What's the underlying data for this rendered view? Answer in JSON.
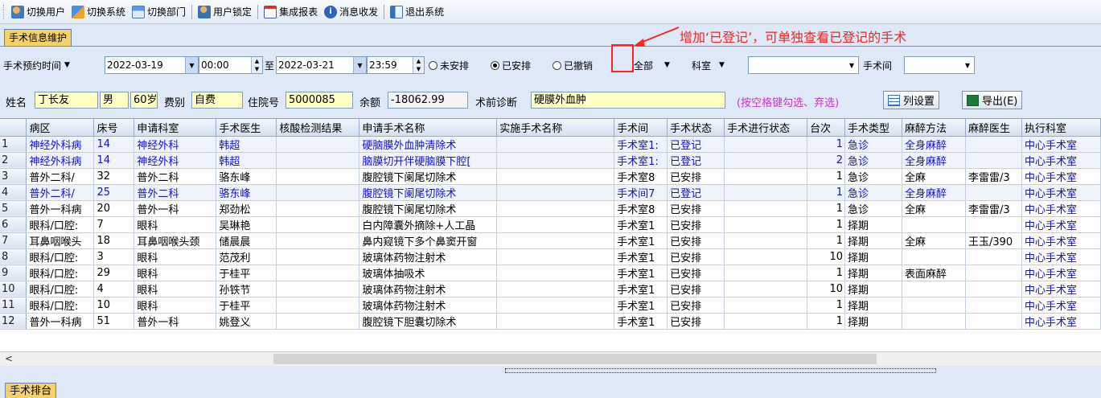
{
  "toolbar": {
    "items": [
      {
        "label": "切换用户",
        "icon": "switch-user-icon"
      },
      {
        "label": "切换系统",
        "icon": "switch-system-icon"
      },
      {
        "label": "切换部门",
        "icon": "switch-dept-icon"
      },
      {
        "label": "用户锁定",
        "icon": "user-lock-icon"
      },
      {
        "label": "集成报表",
        "icon": "report-icon"
      },
      {
        "label": "消息收发",
        "icon": "info-icon"
      },
      {
        "label": "退出系统",
        "icon": "exit-icon"
      }
    ]
  },
  "top_tab": "手术信息维护",
  "annotation": "增加‘已登记’，可单独查看已登记的手术",
  "filter": {
    "time_type": "手术预约时间",
    "date_from": "2022-03-19",
    "time_from": "00:00",
    "to_label": "至",
    "date_to": "2022-03-21",
    "time_to": "23:59",
    "radios": [
      {
        "label": "未安排",
        "checked": false
      },
      {
        "label": "已安排",
        "checked": true
      },
      {
        "label": "已撤销",
        "checked": false
      }
    ],
    "scope": "全部",
    "dept_type": "科室",
    "dept_value": "",
    "room_label": "手术间",
    "room_value": ""
  },
  "patient": {
    "name_label": "姓名",
    "name": "丁长友",
    "sex": "男",
    "age": "60岁",
    "fee_label": "费别",
    "fee": "自费",
    "inpatient_label": "住院号",
    "inpatient_no": "5000085",
    "balance_label": "余额",
    "balance": "-18062.99",
    "diag_label": "术前诊断",
    "diag": "硬膜外血肿",
    "hint": "(按空格键勾选、弃选)",
    "col_settings": "列设置",
    "export": "导出(E)"
  },
  "grid": {
    "columns": [
      "病区",
      "床号",
      "申请科室",
      "手术医生",
      "核酸检测结果",
      "申请手术名称",
      "实施手术名称",
      "手术间",
      "手术状态",
      "手术进行状态",
      "台次",
      "手术类型",
      "麻醉方法",
      "麻醉医生",
      "执行科室"
    ],
    "rows": [
      {
        "n": "1",
        "blue": true,
        "sel": true,
        "c": [
          "神经外科病",
          "14",
          "神经外科",
          "韩超",
          "",
          "硬脑膜外血肿清除术",
          "",
          "手术室1:",
          "已登记",
          "",
          "1",
          "急诊",
          "全身麻醉",
          "",
          "中心手术室"
        ]
      },
      {
        "n": "2",
        "blue": true,
        "sel": true,
        "c": [
          "神经外科病",
          "14",
          "神经外科",
          "韩超",
          "",
          "脑膜切开伴硬脑膜下腔[",
          "",
          "手术室1:",
          "已登记",
          "",
          "2",
          "急诊",
          "全身麻醉",
          "",
          "中心手术室"
        ]
      },
      {
        "n": "3",
        "blue": false,
        "sel": false,
        "c": [
          "普外二科/",
          "32",
          "普外二科",
          "骆东峰",
          "",
          "腹腔镜下阑尾切除术",
          "",
          "手术室8",
          "已安排",
          "",
          "1",
          "急诊",
          "全麻",
          "李雷雷/3",
          "中心手术室"
        ]
      },
      {
        "n": "4",
        "blue": true,
        "sel": true,
        "c": [
          "普外二科/",
          "25",
          "普外二科",
          "骆东峰",
          "",
          "腹腔镜下阑尾切除术",
          "",
          "手术间7",
          "已登记",
          "",
          "1",
          "急诊",
          "全身麻醉",
          "",
          "中心手术室"
        ]
      },
      {
        "n": "5",
        "blue": false,
        "sel": false,
        "c": [
          "普外一科病",
          "20",
          "普外一科",
          "郑劲松",
          "",
          "腹腔镜下阑尾切除术",
          "",
          "手术室8",
          "已安排",
          "",
          "1",
          "急诊",
          "全麻",
          "李雷雷/3",
          "中心手术室"
        ]
      },
      {
        "n": "6",
        "blue": false,
        "sel": false,
        "c": [
          "眼科/口腔:",
          "7",
          "眼科",
          "吴琳艳",
          "",
          "白内障囊外摘除+人工晶",
          "",
          "手术室1",
          "已安排",
          "",
          "1",
          "择期",
          "",
          "",
          "中心手术室"
        ]
      },
      {
        "n": "7",
        "blue": false,
        "sel": false,
        "c": [
          "耳鼻咽喉头",
          "18",
          "耳鼻咽喉头颈",
          "储晨晨",
          "",
          "鼻内窥镜下多个鼻窦开窗",
          "",
          "手术室1",
          "已安排",
          "",
          "1",
          "择期",
          "全麻",
          "王玉/390",
          "中心手术室"
        ]
      },
      {
        "n": "8",
        "blue": false,
        "sel": false,
        "c": [
          "眼科/口腔:",
          "3",
          "眼科",
          "范茂利",
          "",
          "玻璃体药物注射术",
          "",
          "手术室1",
          "已安排",
          "",
          "10",
          "择期",
          "",
          "",
          "中心手术室"
        ]
      },
      {
        "n": "9",
        "blue": false,
        "sel": false,
        "c": [
          "眼科/口腔:",
          "29",
          "眼科",
          "于桂平",
          "",
          "玻璃体抽吸术",
          "",
          "手术室1",
          "已安排",
          "",
          "1",
          "择期",
          "表面麻醉",
          "",
          "中心手术室"
        ]
      },
      {
        "n": "10",
        "blue": false,
        "sel": false,
        "c": [
          "眼科/口腔:",
          "4",
          "眼科",
          "孙铁节",
          "",
          "玻璃体药物注射术",
          "",
          "手术室1",
          "已安排",
          "",
          "10",
          "择期",
          "",
          "",
          "中心手术室"
        ]
      },
      {
        "n": "11",
        "blue": false,
        "sel": false,
        "c": [
          "眼科/口腔:",
          "10",
          "眼科",
          "于桂平",
          "",
          "玻璃体药物注射术",
          "",
          "手术室1",
          "已安排",
          "",
          "1",
          "择期",
          "",
          "",
          "中心手术室"
        ]
      },
      {
        "n": "12",
        "blue": false,
        "sel": false,
        "c": [
          "普外一科病",
          "51",
          "普外一科",
          "姚登义",
          "",
          "腹腔镜下胆囊切除术",
          "",
          "手术室1",
          "已安排",
          "",
          "1",
          "择期",
          "",
          "",
          "中心手术室"
        ]
      }
    ]
  },
  "bottom_tab": "手术排台"
}
